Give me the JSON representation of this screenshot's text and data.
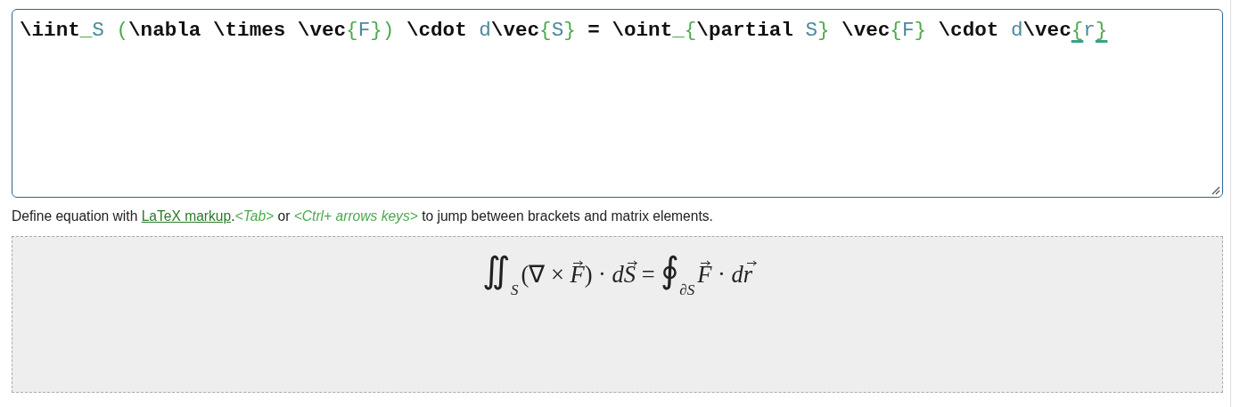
{
  "editor": {
    "tokens": [
      {
        "kind": "command",
        "text": "\\iint",
        "matched": false
      },
      {
        "kind": "symbol",
        "text": "_",
        "matched": false
      },
      {
        "kind": "arg",
        "text": "S ",
        "matched": false
      },
      {
        "kind": "symbol",
        "text": "(",
        "matched": false
      },
      {
        "kind": "command",
        "text": "\\nabla \\times \\vec",
        "matched": false
      },
      {
        "kind": "symbol",
        "text": "{",
        "matched": false
      },
      {
        "kind": "arg",
        "text": "F",
        "matched": false
      },
      {
        "kind": "symbol",
        "text": "})",
        "matched": false
      },
      {
        "kind": "command",
        "text": " \\cdot ",
        "matched": false
      },
      {
        "kind": "arg",
        "text": "d",
        "matched": false
      },
      {
        "kind": "command",
        "text": "\\vec",
        "matched": false
      },
      {
        "kind": "symbol",
        "text": "{",
        "matched": false
      },
      {
        "kind": "arg",
        "text": "S",
        "matched": false
      },
      {
        "kind": "symbol",
        "text": "}",
        "matched": false
      },
      {
        "kind": "command",
        "text": " = \\oint",
        "matched": false
      },
      {
        "kind": "symbol",
        "text": "_{",
        "matched": false
      },
      {
        "kind": "command",
        "text": "\\partial ",
        "matched": false
      },
      {
        "kind": "arg",
        "text": "S",
        "matched": false
      },
      {
        "kind": "symbol",
        "text": "}",
        "matched": false
      },
      {
        "kind": "command",
        "text": " \\vec",
        "matched": false
      },
      {
        "kind": "symbol",
        "text": "{",
        "matched": false
      },
      {
        "kind": "arg",
        "text": "F",
        "matched": false
      },
      {
        "kind": "symbol",
        "text": "}",
        "matched": false
      },
      {
        "kind": "command",
        "text": " \\cdot ",
        "matched": false
      },
      {
        "kind": "arg",
        "text": "d",
        "matched": false
      },
      {
        "kind": "command",
        "text": "\\vec",
        "matched": false
      },
      {
        "kind": "symbol",
        "text": "{",
        "matched": true
      },
      {
        "kind": "arg",
        "text": "r",
        "matched": false
      },
      {
        "kind": "symbol",
        "text": "}",
        "matched": true
      }
    ]
  },
  "help": {
    "before": "Define equation with ",
    "link": "LaTeX markup",
    "after": ".*<Tab>* or *<Ctrl+ arrows keys>* to jump between brackets and matrix elements."
  },
  "preview": {
    "formula": [
      {
        "kind": "bigop",
        "text": "∬"
      },
      {
        "kind": "sub",
        "text": "S"
      },
      {
        "kind": "text",
        "text": "(∇ × "
      },
      {
        "kind": "vec",
        "text": "F"
      },
      {
        "kind": "text",
        "text": ") · "
      },
      {
        "kind": "var",
        "text": "d"
      },
      {
        "kind": "vec",
        "text": "S"
      },
      {
        "kind": "text",
        "text": " = "
      },
      {
        "kind": "bigop",
        "text": "∮"
      },
      {
        "kind": "sub",
        "text": "∂S"
      },
      {
        "kind": "vec",
        "text": "F"
      },
      {
        "kind": "text",
        "text": " · "
      },
      {
        "kind": "var",
        "text": "d"
      },
      {
        "kind": "vec",
        "text": "r"
      }
    ]
  }
}
